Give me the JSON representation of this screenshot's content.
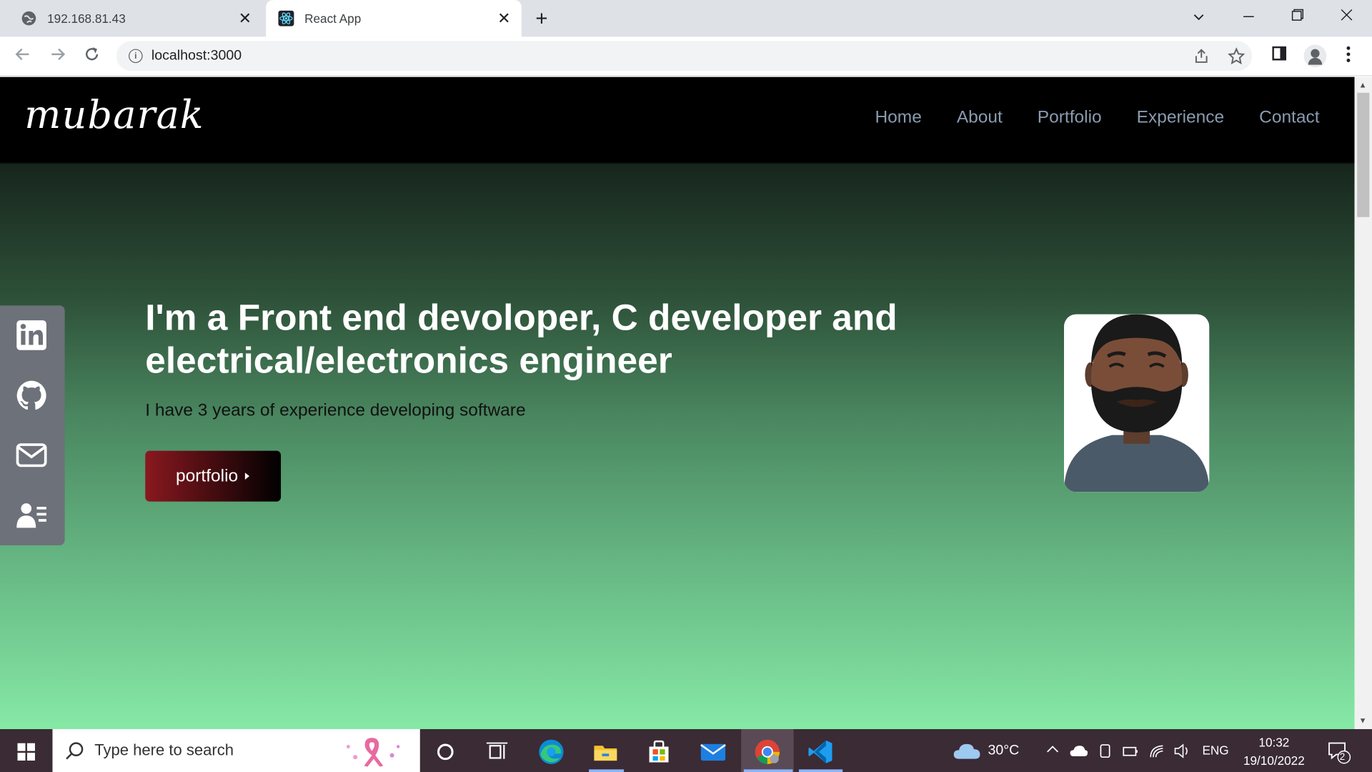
{
  "browser": {
    "tabs": [
      {
        "title": "192.168.81.43",
        "close": "✕"
      },
      {
        "title": "React App",
        "close": "✕"
      }
    ],
    "new_tab": "+",
    "url": "localhost:3000"
  },
  "site": {
    "logo": "mubarak",
    "nav": [
      "Home",
      "About",
      "Portfolio",
      "Experience",
      "Contact"
    ],
    "headline": "I'm a Front end devoloper, C developer and electrical/electronics engineer",
    "subtitle": "I have 3 years of experience developing software",
    "cta": "portfolio",
    "social_icons": [
      "linkedin-icon",
      "github-icon",
      "mail-icon",
      "resume-icon"
    ],
    "colors": {
      "gradient_top": "#1a2a20",
      "gradient_bottom": "#86e9a6",
      "cta_start": "#8a1820",
      "nav_link": "#8a9bb0"
    }
  },
  "taskbar": {
    "search_placeholder": "Type here to search",
    "weather": "30°C",
    "language": "ENG",
    "time": "10:32",
    "date": "19/10/2022",
    "notifications": "2"
  }
}
